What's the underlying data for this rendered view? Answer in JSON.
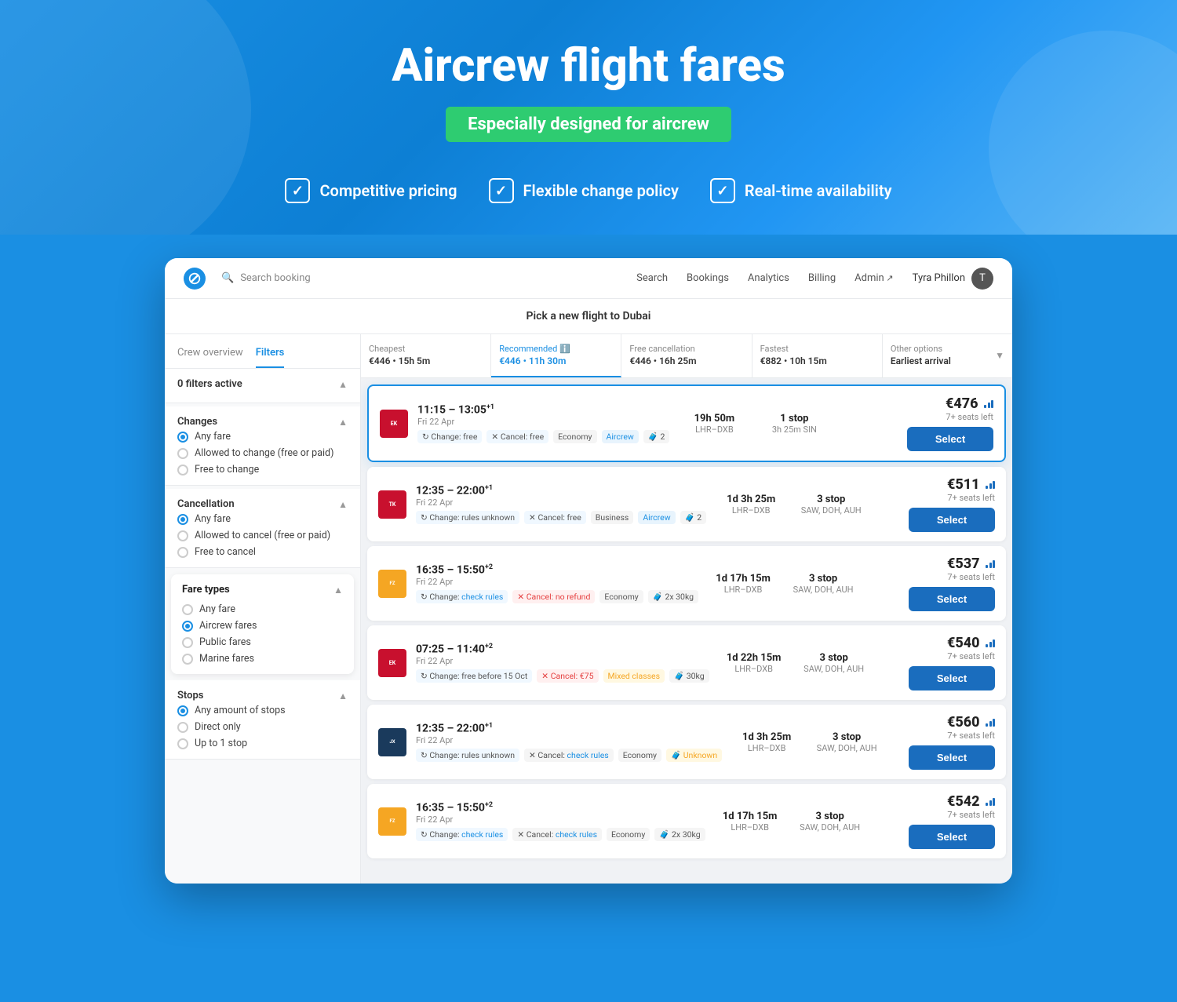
{
  "hero": {
    "title": "Aircrew flight fares",
    "subtitle": "Especially designed for aircrew",
    "features": [
      {
        "id": "pricing",
        "label": "Competitive pricing"
      },
      {
        "id": "change",
        "label": "Flexible change policy"
      },
      {
        "id": "availability",
        "label": "Real-time availability"
      }
    ]
  },
  "topnav": {
    "search_placeholder": "Search booking",
    "links": [
      "Search",
      "Bookings",
      "Analytics",
      "Billing",
      "Admin"
    ],
    "user": "Tyra Phillon"
  },
  "page_title": "Pick a new flight to Dubai",
  "sidebar": {
    "tabs": [
      "Crew overview",
      "Filters"
    ],
    "active_tab": "Filters",
    "filters_active": "0 filters active",
    "sections": {
      "changes": {
        "label": "Changes",
        "options": [
          "Any fare",
          "Allowed to change (free or paid)",
          "Free to change"
        ]
      },
      "cancellation": {
        "label": "Cancellation",
        "options": [
          "Any fare",
          "Allowed to cancel (free or paid)",
          "Free to cancel"
        ]
      },
      "fare_types": {
        "label": "Fare types",
        "options": [
          "Any fare",
          "Aircrew fares",
          "Public fares",
          "Marine fares"
        ],
        "selected": "Aircrew fares"
      },
      "stops": {
        "label": "Stops",
        "options": [
          "Any amount of stops",
          "Direct only",
          "Up to 1 stop"
        ],
        "selected": "Any amount of stops",
        "filter_label": "amount of stops"
      }
    }
  },
  "sort_tabs": [
    {
      "id": "cheapest",
      "label": "Cheapest",
      "value": "€446 • 15h 5m",
      "active": false
    },
    {
      "id": "recommended",
      "label": "Recommended",
      "value": "€446 • 11h 30m",
      "active": true
    },
    {
      "id": "free_cancellation",
      "label": "Free cancellation",
      "value": "€446 • 16h 25m",
      "active": false
    },
    {
      "id": "fastest",
      "label": "Fastest",
      "value": "€882 • 10h 15m",
      "active": false
    },
    {
      "id": "other_options",
      "label": "Other options",
      "sublabel": "Earliest arrival",
      "active": false
    }
  ],
  "flights": [
    {
      "id": "flight-1",
      "highlighted": true,
      "airline": "Emirates",
      "airline_code": "EK",
      "time_range": "11:15 – 13:05",
      "time_superscript": "+1",
      "date": "Fri 22 Apr",
      "change_tag": "Change: free",
      "cancel_tag": "Cancel: free",
      "cancel_type": "free",
      "cabin": "Economy",
      "fare_type": "Aircrew",
      "baggage": "2",
      "duration": "19h 50m",
      "route": "LHR–DXB",
      "stops_count": "1 stop",
      "stops_via": "3h 25m SIN",
      "price": "€476",
      "seats": "7+ seats left",
      "select_label": "Select"
    },
    {
      "id": "flight-2",
      "highlighted": false,
      "airline": "Turkish",
      "airline_code": "TK",
      "time_range": "12:35 – 22:00",
      "time_superscript": "+1",
      "date": "Fri 22 Apr",
      "change_tag": "Change: rules unknown",
      "cancel_tag": "Cancel: free",
      "cancel_type": "free",
      "cabin": "Business",
      "fare_type": "Aircrew",
      "baggage": "2",
      "duration": "1d 3h 25m",
      "route": "LHR–DXB",
      "stops_count": "3 stop",
      "stops_via": "SAW, DOH, AUH",
      "price": "€511",
      "seats": "7+ seats left",
      "select_label": "Select"
    },
    {
      "id": "flight-3",
      "highlighted": false,
      "airline": "FlyDubai",
      "airline_code": "FZ",
      "time_range": "16:35 – 15:50",
      "time_superscript": "+2",
      "date": "Fri 22 Apr",
      "change_tag": "Change: check rules",
      "change_rules_link": true,
      "cancel_tag": "Cancel: no refund",
      "cancel_type": "no_refund",
      "cabin": "Economy",
      "fare_type": null,
      "baggage": "2x 30kg",
      "duration": "1d 17h 15m",
      "route": "LHR–DXB",
      "stops_count": "3 stop",
      "stops_via": "SAW, DOH, AUH",
      "price": "€537",
      "seats": "7+ seats left",
      "select_label": "Select"
    },
    {
      "id": "flight-4",
      "highlighted": false,
      "airline": "Emirates",
      "airline_code": "EK",
      "time_range": "07:25 – 11:40",
      "time_superscript": "+2",
      "date": "Fri 22 Apr",
      "change_tag": "Change: free before 15 Oct",
      "cancel_tag": "Cancel: €75",
      "cancel_type": "paid",
      "cabin": "Mixed classes",
      "fare_type": null,
      "baggage": "30kg",
      "duration": "1d 22h 15m",
      "route": "LHR–DXB",
      "stops_count": "3 stop",
      "stops_via": "SAW, DOH, AUH",
      "price": "€540",
      "seats": "7+ seats left",
      "select_label": "Select"
    },
    {
      "id": "flight-5",
      "highlighted": false,
      "airline": "Starlux",
      "airline_code": "JX",
      "time_range": "12:35 – 22:00",
      "time_superscript": "+1",
      "date": "Fri 22 Apr",
      "change_tag": "Change: rules unknown",
      "cancel_tag": "Cancel: check rules",
      "cancel_type": "rules",
      "cabin": "Economy",
      "fare_type": null,
      "baggage_label": "Unknown",
      "duration": "1d 3h 25m",
      "route": "LHR–DXB",
      "stops_count": "3 stop",
      "stops_via": "SAW, DOH, AUH",
      "price": "€560",
      "seats": "7+ seats left",
      "select_label": "Select"
    },
    {
      "id": "flight-6",
      "highlighted": false,
      "airline": "FlyDubai",
      "airline_code": "FZ",
      "time_range": "16:35 – 15:50",
      "time_superscript": "+2",
      "date": "Fri 22 Apr",
      "change_tag": "Change: check rules",
      "cancel_tag": "Cancel: check rules",
      "cancel_type": "rules",
      "cabin": "Economy",
      "fare_type": null,
      "baggage": "2x 30kg",
      "duration": "1d 17h 15m",
      "route": "LHR–DXB",
      "stops_count": "3 stop",
      "stops_via": "SAW, DOH, AUH",
      "price": "€542",
      "seats": "7+ seats left",
      "select_label": "Select"
    }
  ]
}
